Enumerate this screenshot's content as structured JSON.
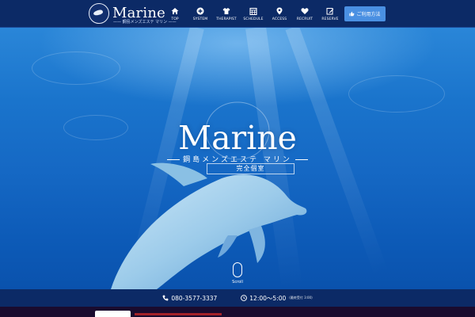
{
  "header": {
    "logo_text": "Marine",
    "logo_sub": "—— 鋼島メンズエステ マリン ——",
    "nav": [
      {
        "label": "TOP",
        "icon": "home-icon"
      },
      {
        "label": "SYSTEM",
        "icon": "plus-circle-icon"
      },
      {
        "label": "THERAPIST",
        "icon": "shirt-icon"
      },
      {
        "label": "SCHEDULE",
        "icon": "calendar-icon"
      },
      {
        "label": "ACCESS",
        "icon": "map-pin-icon"
      },
      {
        "label": "RECRUIT",
        "icon": "heart-icon"
      },
      {
        "label": "RESERVE",
        "icon": "edit-icon"
      }
    ],
    "reserve_button": "ご利用方法"
  },
  "hero": {
    "title": "Marine",
    "subtitle": "鋼島メンズエステ マリン",
    "badge": "完全個室",
    "scroll_label": "Scroll"
  },
  "info_bar": {
    "phone": "080-3577-3337",
    "hours": "12:00～5:00",
    "hours_note": "(最終受付 3:00)"
  },
  "colors": {
    "header_bg": "#0c2a66",
    "accent_button": "#4a90e2",
    "ocean": "#1a74cc"
  }
}
